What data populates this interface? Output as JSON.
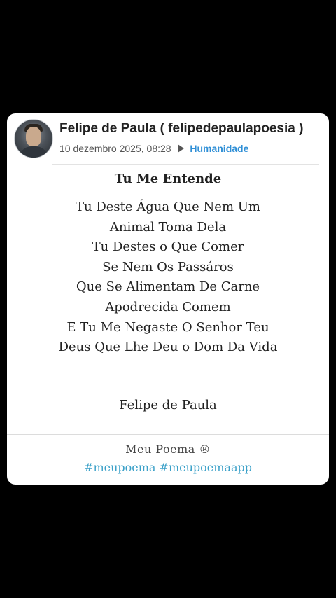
{
  "post": {
    "author": "Felipe de Paula ( felipedepaulapoesia )",
    "date": "10 dezembro 2025, 08:28",
    "category": "Humanidade",
    "title": "Tu Me Entende",
    "lines": [
      "Tu Deste Água Que Nem Um",
      "Animal Toma Dela",
      "Tu Destes o Que Comer",
      "Se Nem Os Passáros",
      "Que Se Alimentam De Carne",
      "Apodrecida Comem",
      "E Tu Me Negaste O Senhor Teu",
      "Deus Que Lhe Deu o Dom Da Vida"
    ],
    "signature": "Felipe de Paula"
  },
  "footer": {
    "brand": "Meu Poema ®",
    "tags": [
      "#meupoema",
      "#meupoemaapp"
    ]
  },
  "icons": {
    "avatar": "avatar-photo",
    "category_arrow": "play-icon"
  },
  "colors": {
    "background": "#000000",
    "card": "#ffffff",
    "category": "#2f8fd6",
    "tags": "#3aa0c8"
  }
}
